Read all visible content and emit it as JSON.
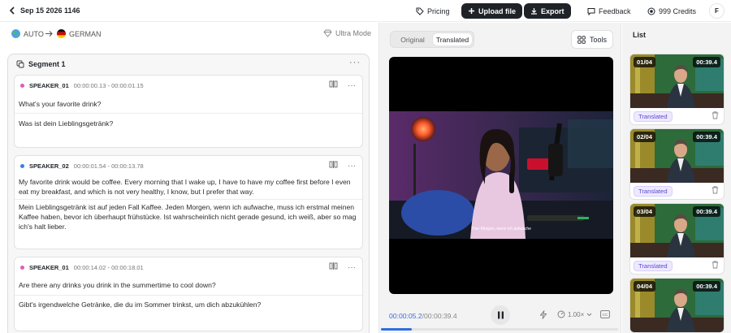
{
  "header": {
    "title": "Sep 15 2026 1146",
    "pricing": "Pricing",
    "upload": "Upload file",
    "export": "Export",
    "feedback": "Feedback",
    "credits": "999 Credits",
    "avatar": "F"
  },
  "languages": {
    "source": "AUTO",
    "target": "GERMAN",
    "mode": "Ultra Mode"
  },
  "segment": {
    "title": "Segment 1",
    "lines": [
      {
        "speaker": "SPEAKER_01",
        "dot_color": "#e05bb8",
        "time": "00:00:00.13 - 00:00:01.15",
        "source": "What's your favorite drink?",
        "translation": "Was ist dein Lieblingsgetränk?"
      },
      {
        "speaker": "SPEAKER_02",
        "dot_color": "#3b7fe0",
        "time": "00:00:01.54 - 00:00:13.78",
        "source": "My favorite drink would be coffee. Every morning that I wake up, I have to have my coffee first before I even eat my breakfast, and which is not very healthy, I know, but I prefer that way.",
        "translation": "Mein Lieblingsgetränk ist auf jeden Fall Kaffee. Jeden Morgen, wenn ich aufwache, muss ich erstmal meinen Kaffee haben, bevor ich überhaupt frühstücke. Ist wahrscheinlich nicht gerade gesund, ich weiß, aber so mag ich's halt lieber."
      },
      {
        "speaker": "SPEAKER_01",
        "dot_color": "#e05bb8",
        "time": "00:00:14.02 - 00:00:18.01",
        "source": "Are there any drinks you drink in the summertime to cool down?",
        "translation": "Gibt's irgendwelche Getränke, die du im Sommer trinkst, um dich abzukühlen?"
      }
    ]
  },
  "viewer": {
    "tab_original": "Original",
    "tab_translated": "Translated",
    "tools": "Tools",
    "subtitle": "Ther Morgen, wenn ich aufwache",
    "current_time": "00:00:05.2",
    "duration": "/00:00:39.4",
    "speed": "1.00×",
    "progress": 0.13
  },
  "list": {
    "title": "List",
    "items": [
      {
        "index": "01/04",
        "duration": "00:39.4",
        "status": "Translated"
      },
      {
        "index": "02/04",
        "duration": "00:39.4",
        "status": "Translated"
      },
      {
        "index": "03/04",
        "duration": "00:39.4",
        "status": "Translated"
      },
      {
        "index": "04/04",
        "duration": "00:39.4",
        "status": ""
      }
    ]
  },
  "colors": {
    "accent": "#2f6fe0",
    "status_bg": "#eee9ff",
    "status_text": "#5b4ad0",
    "dark_button": "#1f2328"
  }
}
